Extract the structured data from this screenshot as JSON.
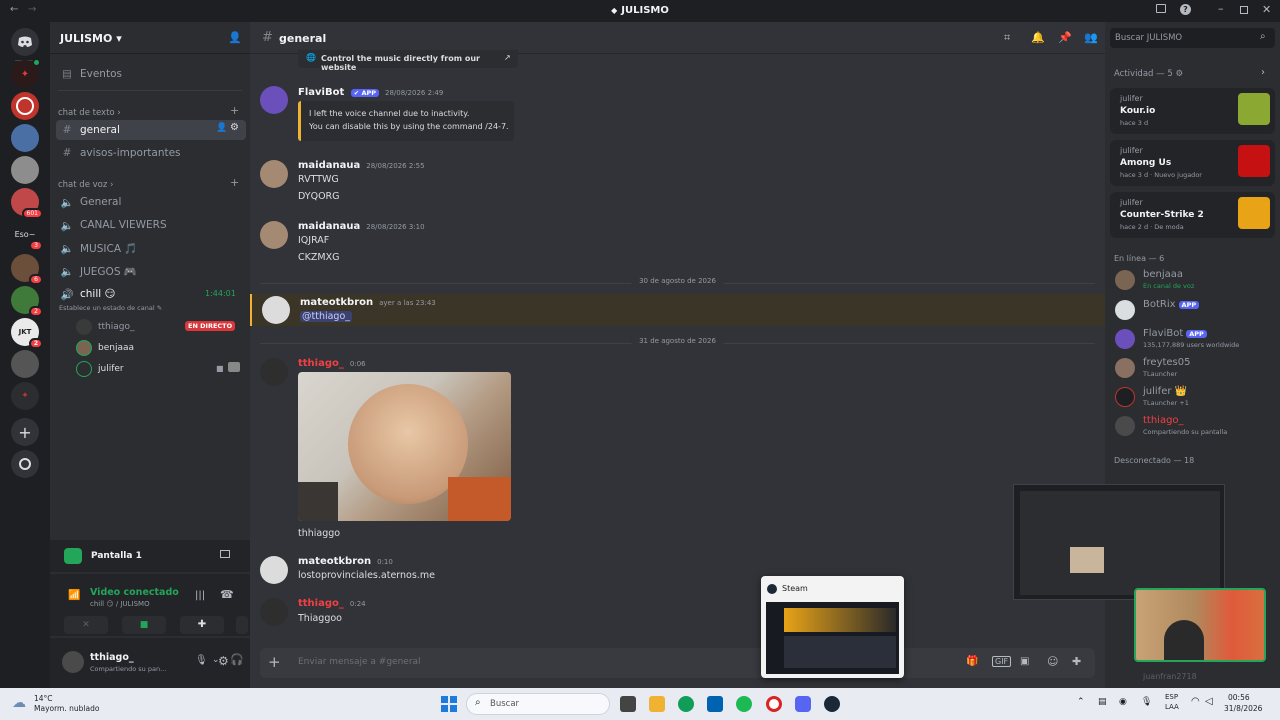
{
  "window": {
    "title": "JULISMO"
  },
  "server": {
    "name": "JULISMO",
    "events_label": "Eventos"
  },
  "channels": {
    "text_category": "chat de texto",
    "text": [
      {
        "name": "general",
        "active": true
      },
      {
        "name": "avisos-importantes",
        "active": false
      }
    ],
    "voice_category": "chat de voz",
    "voice": [
      {
        "name": "General"
      },
      {
        "name": "CANAL VIEWERS"
      },
      {
        "name": "MUSICA 🎵"
      },
      {
        "name": "JUEGOS 🎮"
      }
    ],
    "chill": {
      "name": "chill 😏",
      "timer": "1:44:01",
      "status": "Establece un estado de canal",
      "users": [
        {
          "name": "tthiago_",
          "badge": "EN DIRECTO"
        },
        {
          "name": "benjaaa"
        },
        {
          "name": "julifer"
        }
      ]
    }
  },
  "guild_badges": [
    "601",
    "3",
    "3",
    "6",
    "2",
    "2",
    "3"
  ],
  "guild_text_label": "Eso~",
  "screen_share": {
    "label": "Pantalla 1"
  },
  "voice_status": {
    "title": "Video conectado",
    "channel": "chill 😏 / JULISMO"
  },
  "user": {
    "name": "tthiago_",
    "status": "Compartiendo su pan..."
  },
  "chat": {
    "channel": "general",
    "top_link": "Control the music directly from our website",
    "messages": [
      {
        "author": "FlaviBot",
        "app": "APP",
        "time": "28/08/2026 2:49",
        "embed": [
          "I left the voice channel due to inactivity.",
          "You can disable this by using the command /24-7."
        ]
      },
      {
        "author": "maidanaua",
        "time": "28/08/2026 2:55",
        "lines": [
          "RVTTWG",
          "DYQORG"
        ]
      },
      {
        "author": "maidanaua",
        "time": "28/08/2026 3:10",
        "lines": [
          "IQJRAF",
          "CKZMXG"
        ]
      },
      {
        "author": "mateotkbron",
        "time": "ayer a las 23:43",
        "lines": [
          "@tthiago_"
        ]
      },
      {
        "author": "tthiago_",
        "time": "0:06",
        "lines": [
          "thhiaggo"
        ]
      },
      {
        "author": "mateotkbron",
        "time": "0:10",
        "lines": [
          "lostoprovinciales.aternos.me"
        ]
      },
      {
        "author": "tthiago_",
        "time": "0:24",
        "lines": [
          "Thiaggoo"
        ]
      }
    ],
    "dividers": [
      "30 de agosto de 2026",
      "31 de agosto de 2026"
    ],
    "input_placeholder": "Enviar mensaje a #general"
  },
  "members": {
    "search_placeholder": "Buscar JULISMO",
    "activity_header": "Actividad — 5",
    "activities": [
      {
        "who": "julifer",
        "game": "Kour.io",
        "ago": "hace 3 d",
        "extra": "",
        "color": "#8aa832"
      },
      {
        "who": "julifer",
        "game": "Among Us",
        "ago": "hace 3 d",
        "extra": "Nuevo jugador",
        "color": "#c51111"
      },
      {
        "who": "julifer",
        "game": "Counter-Strike 2",
        "ago": "hace 2 d",
        "extra": "De moda",
        "color": "#e8a317"
      }
    ],
    "online_header": "En línea — 6",
    "online": [
      {
        "name": "benjaaa",
        "status": "En canal de voz",
        "app": ""
      },
      {
        "name": "BotRix",
        "status": "",
        "app": "APP"
      },
      {
        "name": "FlaviBot",
        "status": "135,177,889 users worldwide",
        "app": "APP"
      },
      {
        "name": "freytes05",
        "status": "TLauncher",
        "app": ""
      },
      {
        "name": "julifer 👑",
        "status": "TLauncher +1",
        "app": ""
      },
      {
        "name": "tthiago_",
        "status": "Compartiendo su pantalla",
        "app": ""
      }
    ],
    "offline_header": "Desconectado — 18",
    "offline_last": "juanfran2718"
  },
  "steam_popup": {
    "title": "Steam"
  },
  "taskbar": {
    "weather_temp": "14°C",
    "weather_desc": "Mayorm. nublado",
    "search": "Buscar",
    "lang1": "ESP",
    "lang2": "LAA",
    "time": "00:56",
    "date": "31/8/2026"
  }
}
